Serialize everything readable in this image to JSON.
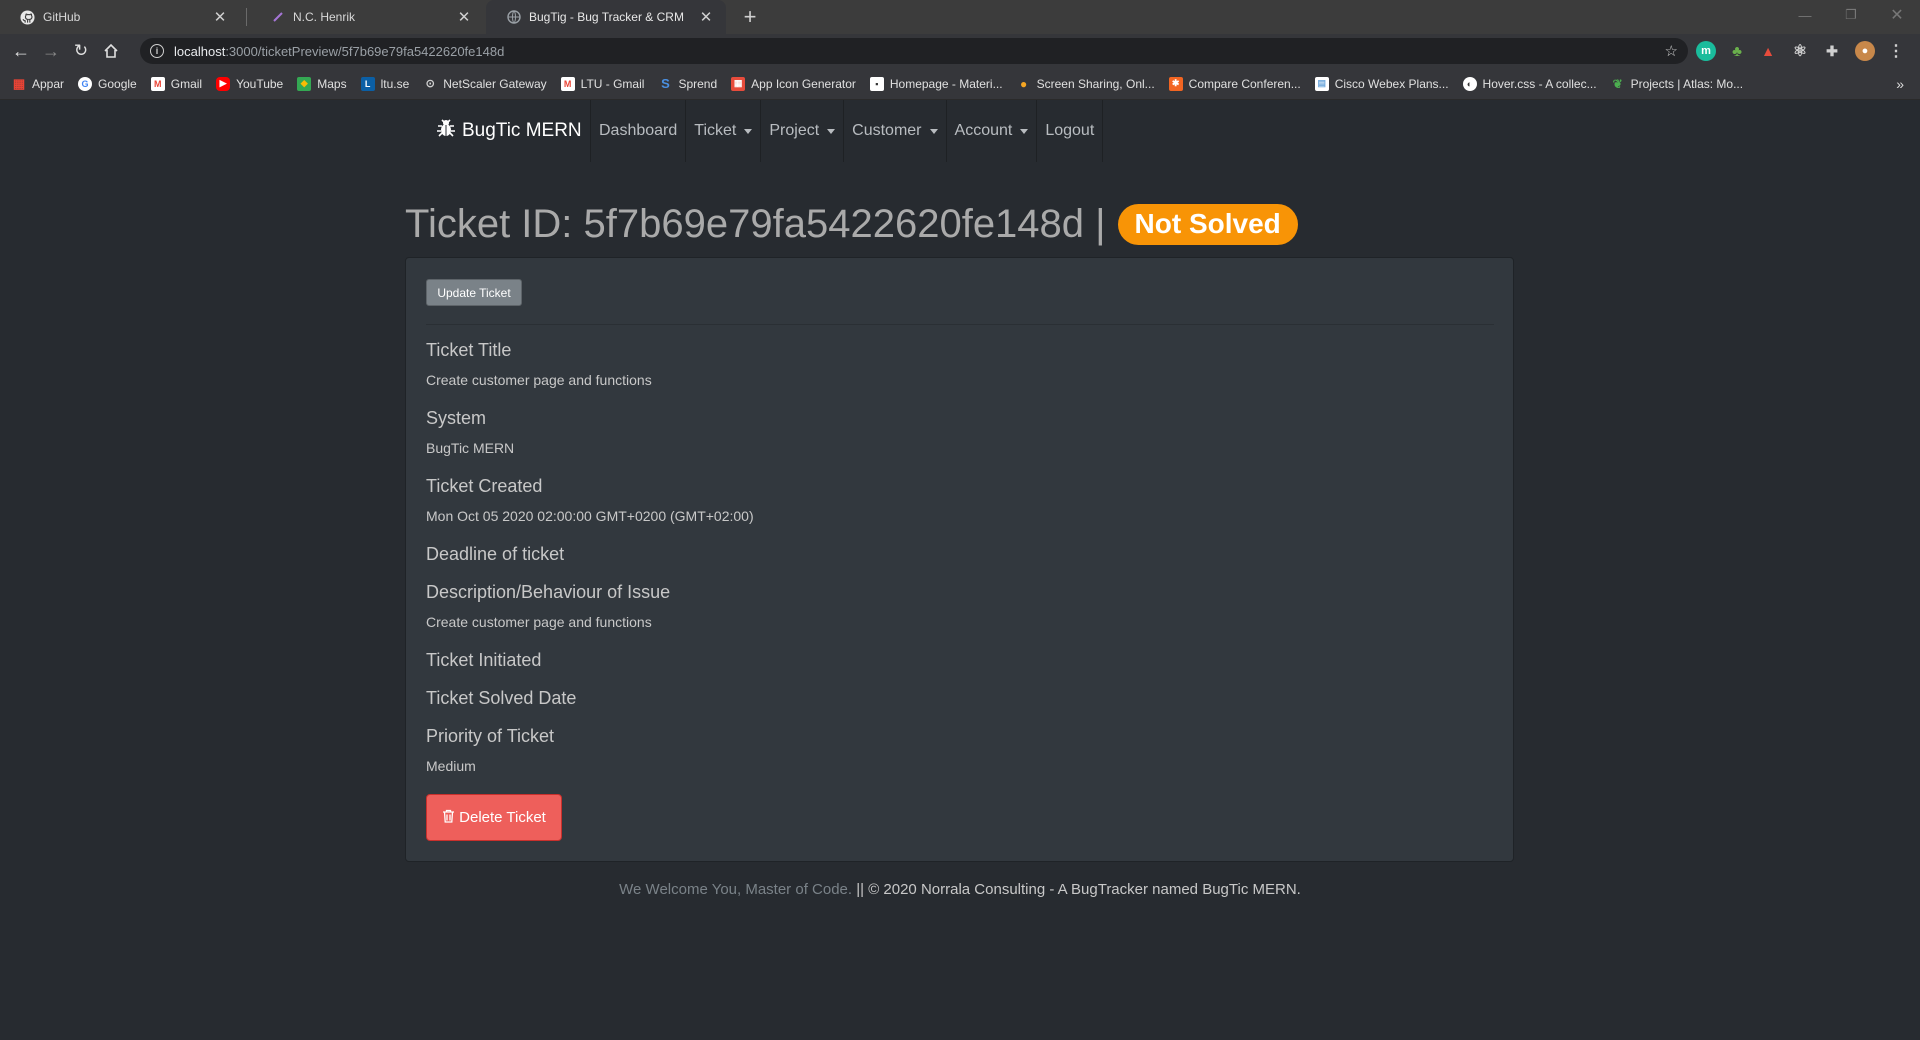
{
  "browser": {
    "tabs": [
      {
        "title": "GitHub",
        "active": false
      },
      {
        "title": "N.C. Henrik",
        "active": false
      },
      {
        "title": "BugTig - Bug Tracker & CRM",
        "active": true
      }
    ],
    "new_tab": "+",
    "url_host": "localhost",
    "url_path": ":3000/ticketPreview/5f7b69e79fa5422620fe148d",
    "bookmarks": [
      {
        "label": "Appar",
        "icon": "apps-grid-icon",
        "color": "#ea4335"
      },
      {
        "label": "Google",
        "icon": "google-icon",
        "color": "#ffffff"
      },
      {
        "label": "Gmail",
        "icon": "gmail-icon",
        "color": "#ea4335"
      },
      {
        "label": "YouTube",
        "icon": "youtube-icon",
        "color": "#ff0000"
      },
      {
        "label": "Maps",
        "icon": "maps-icon",
        "color": "#34a853"
      },
      {
        "label": "ltu.se",
        "icon": "ltu-icon",
        "color": "#0b5fa5"
      },
      {
        "label": "NetScaler Gateway",
        "icon": "lock-icon",
        "color": "#d0d0d0"
      },
      {
        "label": "LTU - Gmail",
        "icon": "gmail-icon",
        "color": "#ea4335"
      },
      {
        "label": "Sprend",
        "icon": "sprend-icon",
        "color": "#4a90e2"
      },
      {
        "label": "App Icon Generator",
        "icon": "app-icon-generator-icon",
        "color": "#e74c3c"
      },
      {
        "label": "Homepage - Materi...",
        "icon": "page-icon",
        "color": "#ffffff"
      },
      {
        "label": "Screen Sharing, Onl...",
        "icon": "screen-sharing-icon",
        "color": "#f5a623"
      },
      {
        "label": "Compare Conferen...",
        "icon": "compare-icon",
        "color": "#f26522"
      },
      {
        "label": "Cisco Webex Plans...",
        "icon": "webex-icon",
        "color": "#6fa8dc"
      },
      {
        "label": "Hover.css - A collec...",
        "icon": "hovercss-icon",
        "color": "#ffffff"
      },
      {
        "label": "Projects | Atlas: Mo...",
        "icon": "mongodb-leaf-icon",
        "color": "#4caf50"
      }
    ],
    "bookmarks_more": "»"
  },
  "app": {
    "brand": "BugTic MERN",
    "nav": [
      {
        "label": "Dashboard",
        "dropdown": false
      },
      {
        "label": "Ticket",
        "dropdown": true
      },
      {
        "label": "Project",
        "dropdown": true
      },
      {
        "label": "Customer",
        "dropdown": true
      },
      {
        "label": "Account",
        "dropdown": true
      },
      {
        "label": "Logout",
        "dropdown": false
      }
    ],
    "heading": "Ticket ID: 5f7b69e79fa5422620fe148d |",
    "status_badge": "Not Solved",
    "status_color": "#f89406",
    "update_button": "Update Ticket",
    "fields": {
      "title_label": "Ticket Title",
      "title_value": "Create customer page and functions",
      "system_label": "System",
      "system_value": "BugTic MERN",
      "created_label": "Ticket Created",
      "created_value": "Mon Oct 05 2020 02:00:00 GMT+0200 (GMT+02:00)",
      "deadline_label": "Deadline of ticket",
      "description_label": "Description/Behaviour of Issue",
      "description_value": "Create customer page and functions",
      "initiated_label": "Ticket Initiated",
      "solved_label": "Ticket Solved Date",
      "priority_label": "Priority of Ticket",
      "priority_value": "Medium"
    },
    "delete_button": "Delete Ticket",
    "delete_color": "#ee5f5b",
    "footer_welcome": "We Welcome You, Master of Code.",
    "footer_copyright": " || © 2020 Norrala Consulting - A BugTracker named BugTic MERN."
  }
}
